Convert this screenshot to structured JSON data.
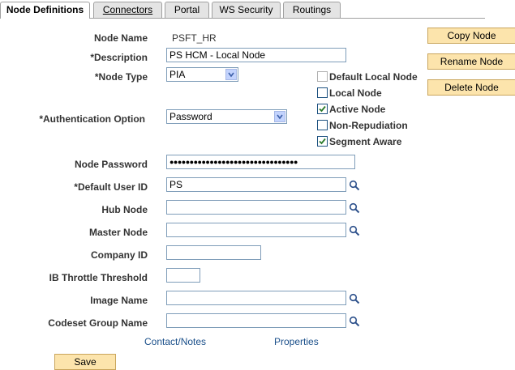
{
  "tabs": [
    {
      "label": "Node Definitions",
      "active": true
    },
    {
      "label": "Connectors",
      "active": false
    },
    {
      "label": "Portal",
      "active": false
    },
    {
      "label": "WS Security",
      "active": false
    },
    {
      "label": "Routings",
      "active": false
    }
  ],
  "form": {
    "node_name_label": "Node Name",
    "node_name_value": "PSFT_HR",
    "description_label": "*Description",
    "description_value": "PS HCM - Local Node",
    "node_type_label": "*Node Type",
    "node_type_value": "PIA",
    "auth_label": "*Authentication Option",
    "auth_value": "Password",
    "node_password_label": "Node Password",
    "node_password_value": "●●●●●●●●●●●●●●●●●●●●●●●●●●●●●●●●",
    "default_user_label": "*Default User ID",
    "default_user_value": "PS",
    "hub_node_label": "Hub Node",
    "hub_node_value": "",
    "master_node_label": "Master Node",
    "master_node_value": "",
    "company_id_label": "Company ID",
    "company_id_value": "",
    "throttle_label": "IB Throttle Threshold",
    "throttle_value": "",
    "image_name_label": "Image Name",
    "image_name_value": "",
    "codeset_label": "Codeset Group Name",
    "codeset_value": ""
  },
  "checkboxes": [
    {
      "label": "Default Local Node",
      "checked": false,
      "disabled": true
    },
    {
      "label": "Local Node",
      "checked": false,
      "disabled": false
    },
    {
      "label": "Active Node",
      "checked": true,
      "disabled": false
    },
    {
      "label": "Non-Repudiation",
      "checked": false,
      "disabled": false
    },
    {
      "label": "Segment Aware",
      "checked": true,
      "disabled": false
    }
  ],
  "buttons": {
    "copy": "Copy Node",
    "rename": "Rename Node",
    "delete": "Delete Node",
    "save": "Save"
  },
  "links": {
    "contact": "Contact/Notes",
    "properties": "Properties"
  },
  "icons": {
    "lookup": "magnifier-icon",
    "dropdown": "chevron-down-icon",
    "check": "check-icon"
  },
  "colors": {
    "tab_border": "#a0a0a0",
    "button_bg": "#fce4ac",
    "link": "#1a4f8a",
    "input_border": "#7f9db9"
  }
}
